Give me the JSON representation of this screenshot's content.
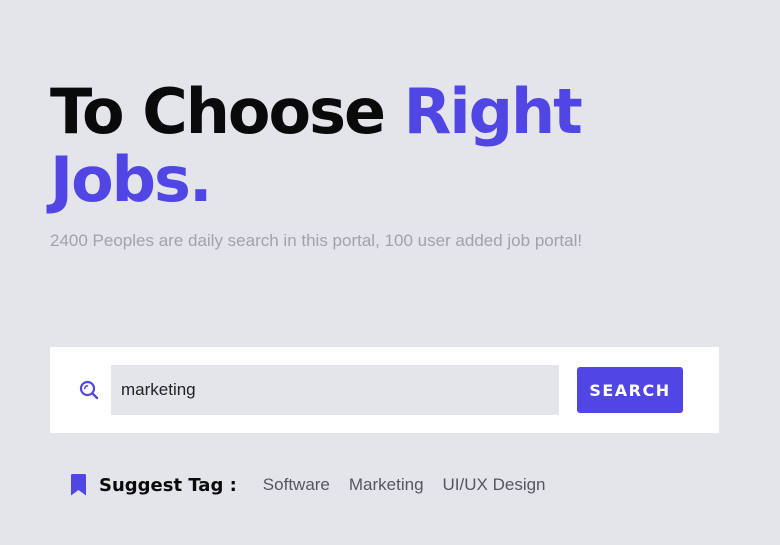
{
  "hero": {
    "title_part1": "To Choose ",
    "title_accent_line1": "Right",
    "title_accent_line2": "Jobs.",
    "subtitle": "2400 Peoples are daily search in this portal, 100 user added job portal!"
  },
  "search": {
    "value": "marketing",
    "icon": "search-icon",
    "button_label": "SEARCH"
  },
  "suggest": {
    "label": "Suggest Tag :",
    "icon": "bookmark-icon",
    "tags": [
      "Software",
      "Marketing",
      "UI/UX Design"
    ]
  },
  "colors": {
    "background": "#e4e5ea",
    "accent": "#5046e4",
    "text_dark": "#0a0a0a",
    "subtitle": "#a0a3ab"
  }
}
